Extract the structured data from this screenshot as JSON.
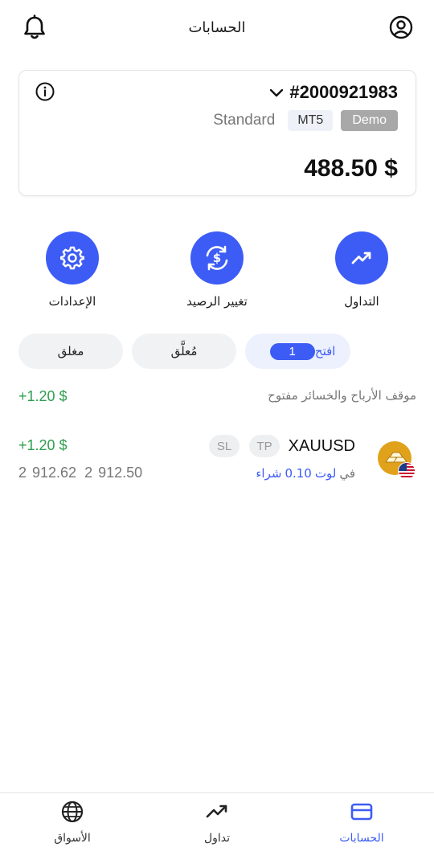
{
  "header": {
    "title": "الحسابات",
    "bell_icon": "bell-icon",
    "profile_icon": "user-circle-icon"
  },
  "account_card": {
    "account_number": "#2000921983",
    "account_type": "Standard",
    "platform": "MT5",
    "mode": "Demo",
    "balance": "488.50 $",
    "info_icon": "info-icon",
    "dropdown_icon": "chevron-down-icon"
  },
  "actions": [
    {
      "label": "التداول",
      "icon": "trending-up-icon"
    },
    {
      "label": "تغيير الرصيد",
      "icon": "dollar-exchange-icon"
    },
    {
      "label": "الإعدادات",
      "icon": "gear-icon"
    }
  ],
  "filters": {
    "open_label": "افتح",
    "open_count": "1",
    "pending_label": "مُعلَّق",
    "closed_label": "مغلق"
  },
  "summary": {
    "label": "موقف الأرباح والخسائر مفتوح",
    "value": "+1.20 $"
  },
  "positions": [
    {
      "symbol": "XAUUSD",
      "tp_label": "TP",
      "sl_label": "SL",
      "pnl": "+1.20 $",
      "side": "شراء",
      "volume": "0.10",
      "unit": "لوت",
      "in_word": "في",
      "open_price": "2 912.50",
      "current_price": "2 912.62",
      "asset_icon": "gold-bars-icon",
      "flag_icon": "us-flag-icon"
    }
  ],
  "tabbar": [
    {
      "label": "الحسابات",
      "icon": "card-icon",
      "active": true
    },
    {
      "label": "تداول",
      "icon": "trending-up-icon",
      "active": false
    },
    {
      "label": "الأسواق",
      "icon": "globe-icon",
      "active": false
    }
  ],
  "colors": {
    "accent": "#3d5cf5",
    "profit": "#2e9e4f",
    "demo_badge": "#a8a8a8"
  }
}
